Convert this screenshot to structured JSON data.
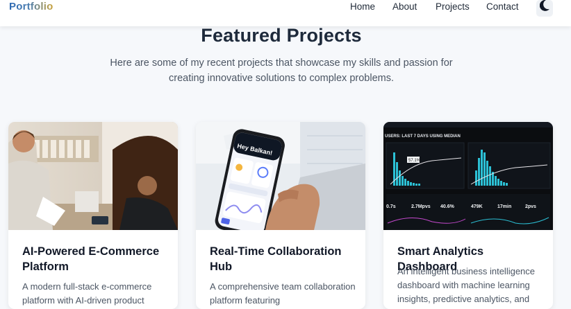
{
  "nav": {
    "brand": "Portfolio",
    "links": [
      "Home",
      "About",
      "Projects",
      "Contact"
    ],
    "theme_toggle_icon": "moon-icon"
  },
  "section": {
    "title": "Featured Projects",
    "subtitle": "Here are some of my recent projects that showcase my skills and passion for creating innovative solutions to complex problems."
  },
  "projects": [
    {
      "title": "AI-Powered E-Commerce Platform",
      "description": "A modern full-stack e-commerce platform with AI-driven product",
      "image": "shopping-checkout-photo"
    },
    {
      "title": "Real-Time Collaboration Hub",
      "description": "A comprehensive team collaboration platform featuring",
      "image": "phone-app-photo",
      "phone_greeting": "Hey Balkan!"
    },
    {
      "title": "Smart Analytics Dashboard",
      "description": "An intelligent business intelligence dashboard with machine learning insights, predictive analytics, and",
      "image": "analytics-screen-photo",
      "screen_header": "USERS: LAST 7 DAYS USING MEDIAN",
      "screen_callout": "57.1%",
      "screen_metrics": [
        "479K",
        "17min",
        "2pvs",
        "0.7s",
        "2.7Mpvs",
        "40.6%"
      ]
    }
  ],
  "colors": {
    "brand_start": "#2f6ab3",
    "brand_end": "#c9a23a",
    "page_bg": "#f6f8fb",
    "heading": "#1e2a3b",
    "dashboard_accent": "#2cc1d6"
  }
}
